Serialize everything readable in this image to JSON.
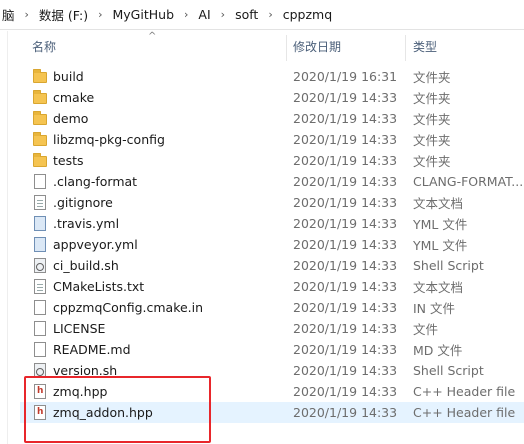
{
  "breadcrumb": [
    "脑",
    "数据 (F:)",
    "MyGitHub",
    "AI",
    "soft",
    "cppzmq"
  ],
  "breadcrumb_sep": "›",
  "columns": {
    "name": "名称",
    "date": "修改日期",
    "type": "类型"
  },
  "sort_arrow": "^",
  "files": [
    {
      "name": "build",
      "date": "2020/1/19 16:31",
      "type": "文件夹",
      "icon": "folder-icon"
    },
    {
      "name": "cmake",
      "date": "2020/1/19 14:33",
      "type": "文件夹",
      "icon": "folder-icon"
    },
    {
      "name": "demo",
      "date": "2020/1/19 14:33",
      "type": "文件夹",
      "icon": "folder-icon"
    },
    {
      "name": "libzmq-pkg-config",
      "date": "2020/1/19 14:33",
      "type": "文件夹",
      "icon": "folder-icon"
    },
    {
      "name": "tests",
      "date": "2020/1/19 14:33",
      "type": "文件夹",
      "icon": "folder-icon"
    },
    {
      "name": ".clang-format",
      "date": "2020/1/19 14:33",
      "type": "CLANG-FORMAT...",
      "icon": "file-icon"
    },
    {
      "name": ".gitignore",
      "date": "2020/1/19 14:33",
      "type": "文本文档",
      "icon": "text-file-icon"
    },
    {
      "name": ".travis.yml",
      "date": "2020/1/19 14:33",
      "type": "YML 文件",
      "icon": "yml-file-icon"
    },
    {
      "name": "appveyor.yml",
      "date": "2020/1/19 14:33",
      "type": "YML 文件",
      "icon": "yml-file-icon"
    },
    {
      "name": "ci_build.sh",
      "date": "2020/1/19 14:33",
      "type": "Shell Script",
      "icon": "shell-script-icon"
    },
    {
      "name": "CMakeLists.txt",
      "date": "2020/1/19 14:33",
      "type": "文本文档",
      "icon": "text-file-icon"
    },
    {
      "name": "cppzmqConfig.cmake.in",
      "date": "2020/1/19 14:33",
      "type": "IN 文件",
      "icon": "file-icon"
    },
    {
      "name": "LICENSE",
      "date": "2020/1/19 14:33",
      "type": "文件",
      "icon": "file-icon"
    },
    {
      "name": "README.md",
      "date": "2020/1/19 14:33",
      "type": "MD 文件",
      "icon": "file-icon"
    },
    {
      "name": "version.sh",
      "date": "2020/1/19 14:33",
      "type": "Shell Script",
      "icon": "shell-script-icon"
    },
    {
      "name": "zmq.hpp",
      "date": "2020/1/19 14:33",
      "type": "C++ Header file",
      "icon": "cpp-header-icon"
    },
    {
      "name": "zmq_addon.hpp",
      "date": "2020/1/19 14:33",
      "type": "C++ Header file",
      "icon": "cpp-header-icon",
      "selected": true
    }
  ],
  "colors": {
    "selection": "#e5f3ff",
    "highlight_box": "#e8262b",
    "folder": "#f5c451",
    "header_text": "#4c607a"
  }
}
